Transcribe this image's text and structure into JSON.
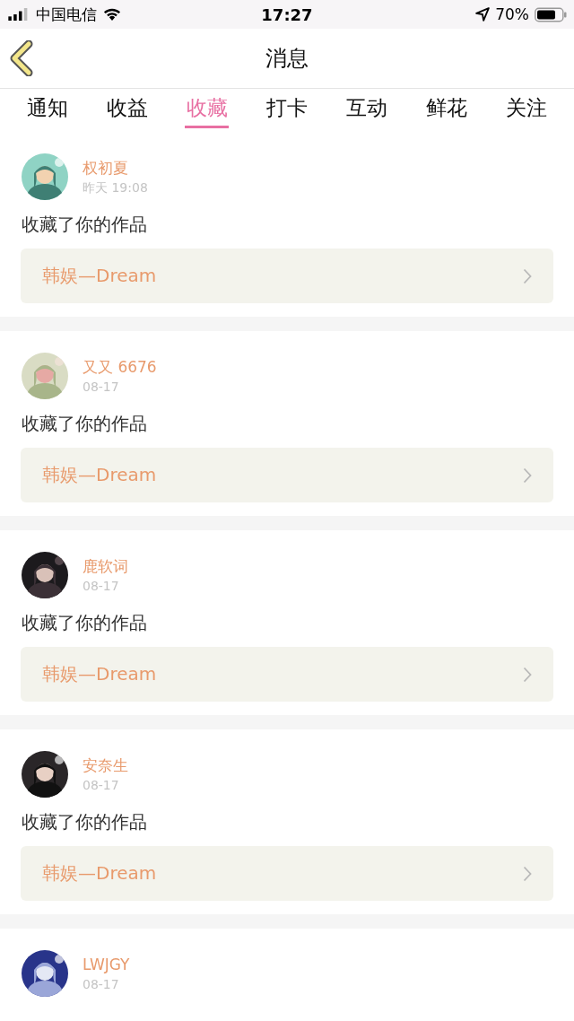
{
  "status_bar": {
    "carrier": "中国电信",
    "time": "17:27",
    "battery": "70%"
  },
  "header": {
    "title": "消息"
  },
  "tabs": [
    {
      "label": "通知",
      "selected": false
    },
    {
      "label": "收益",
      "selected": false
    },
    {
      "label": "收藏",
      "selected": true
    },
    {
      "label": "打卡",
      "selected": false
    },
    {
      "label": "互动",
      "selected": false
    },
    {
      "label": "鲜花",
      "selected": false
    },
    {
      "label": "关注",
      "selected": false
    }
  ],
  "messages": [
    {
      "name": "权初夏",
      "time": "昨天 19:08",
      "action": "收藏了你的作品",
      "work": "韩娱—Dream"
    },
    {
      "name": "又又 6676",
      "time": "08-17",
      "action": "收藏了你的作品",
      "work": "韩娱—Dream"
    },
    {
      "name": "鹿软词",
      "time": "08-17",
      "action": "收藏了你的作品",
      "work": "韩娱—Dream"
    },
    {
      "name": "安奈生",
      "time": "08-17",
      "action": "收藏了你的作品",
      "work": "韩娱—Dream"
    },
    {
      "name": "LWJGY",
      "time": "08-17"
    }
  ]
}
